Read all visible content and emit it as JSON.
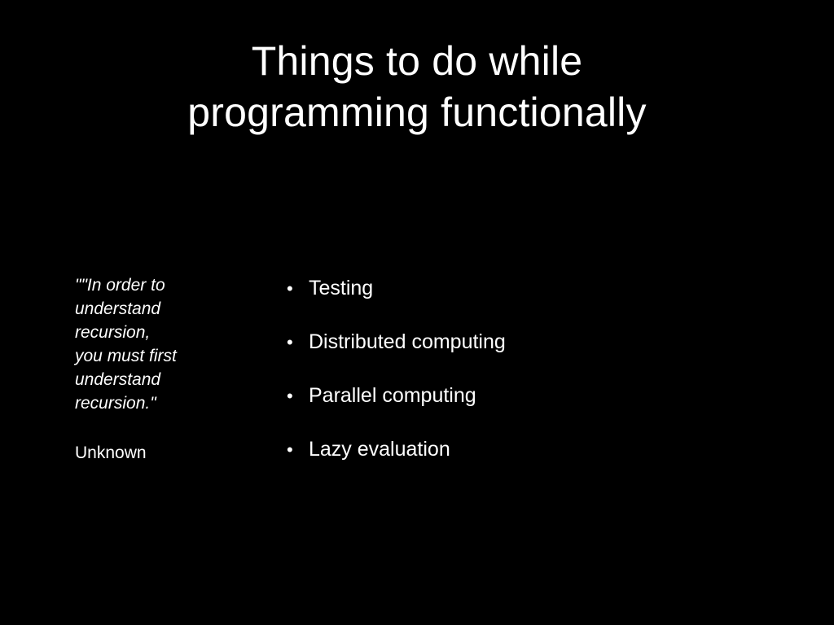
{
  "slide": {
    "title_lines": [
      "Things to do while",
      "programming functionally"
    ],
    "quote": {
      "lines": [
        "\"\"In order to",
        "understand",
        "recursion,",
        "you must first",
        "understand",
        "recursion.\""
      ],
      "author": "Unknown"
    },
    "bullet_glyph": "•",
    "bullets": [
      "Testing",
      "Distributed computing",
      "Parallel computing",
      "Lazy evaluation"
    ]
  },
  "colors": {
    "background": "#000000",
    "text": "#ffffff"
  }
}
